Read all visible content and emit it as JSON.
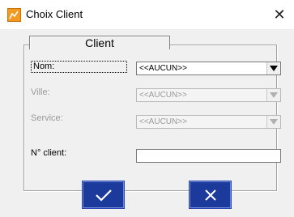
{
  "window": {
    "title": "Choix Client",
    "close_glyph": "✕",
    "icon": "app-icon"
  },
  "group": {
    "title": "Client"
  },
  "fields": {
    "nom": {
      "label": "Nom:",
      "value": "<<AUCUN>>",
      "enabled": true
    },
    "ville": {
      "label": "Ville:",
      "value": "<<AUCUN>>",
      "enabled": false
    },
    "service": {
      "label": "Service:",
      "value": "<<AUCUN>>",
      "enabled": false
    },
    "n_client": {
      "label": "N° client:",
      "value": ""
    }
  },
  "buttons": {
    "ok": {
      "icon": "checkmark-icon"
    },
    "cancel": {
      "icon": "cross-icon"
    }
  },
  "colors": {
    "button_bg": "#1c3a9c",
    "app_icon": "#f29a1f"
  }
}
